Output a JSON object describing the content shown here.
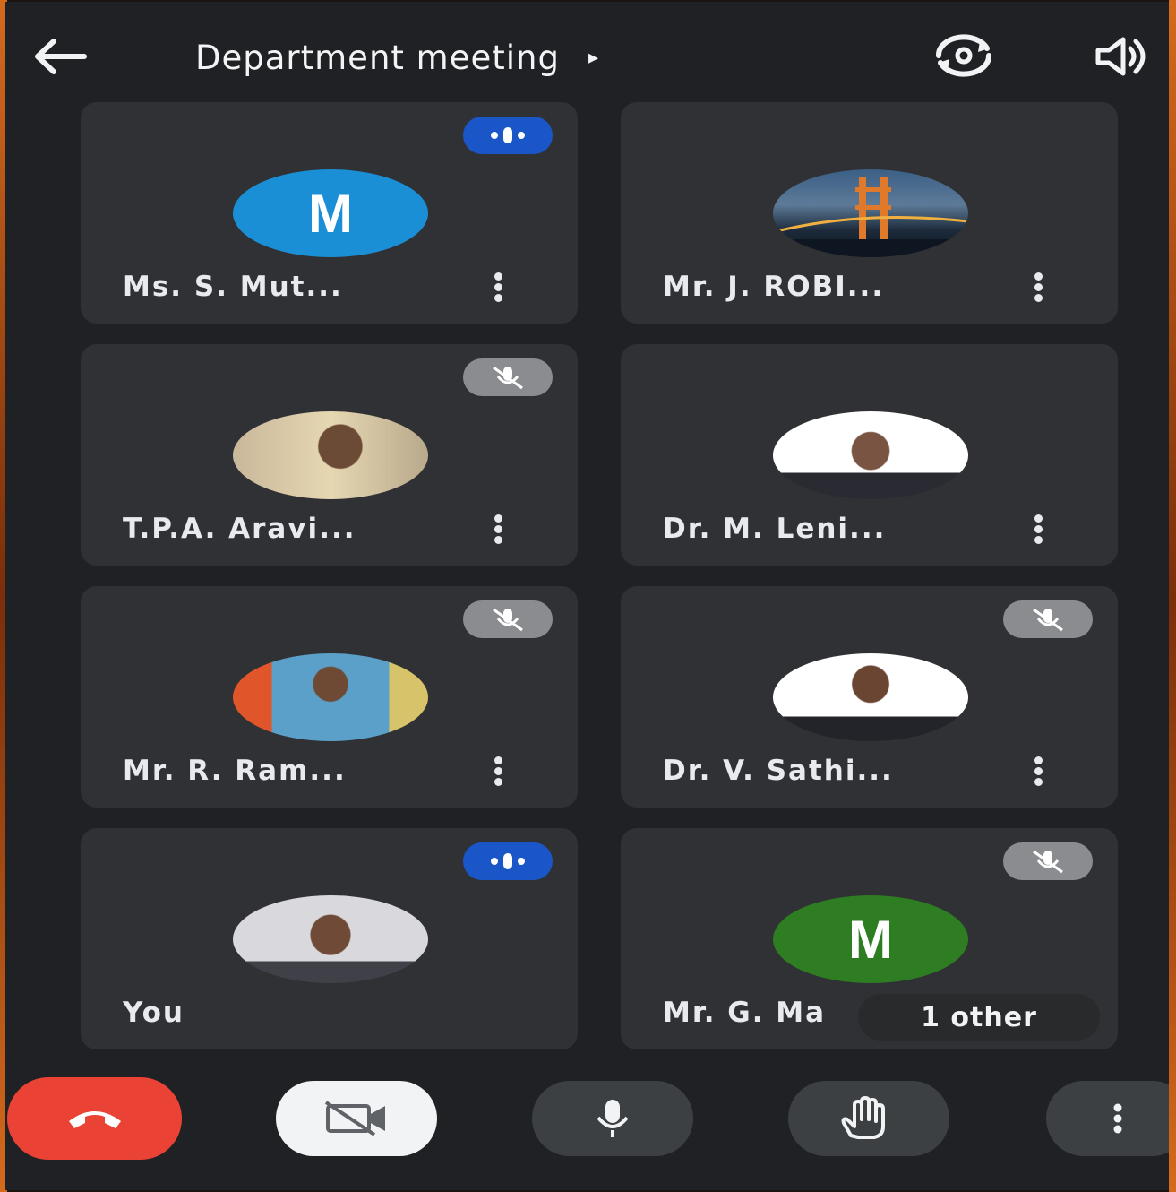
{
  "header": {
    "title": "Department meeting",
    "title_caret": "▸",
    "back_icon": "arrow-left-icon",
    "camera_flip_icon": "camera-flip-icon",
    "speaker_icon": "speaker-icon"
  },
  "participants": [
    {
      "name": "Ms. S. Mut...",
      "avatar_type": "initial",
      "initial": "M",
      "avatar_color": "#1a8fd6",
      "status": "speaking"
    },
    {
      "name": "Mr. J. ROBI...",
      "avatar_type": "photo",
      "status": "none"
    },
    {
      "name": "T.P.A. Aravi...",
      "avatar_type": "photo",
      "status": "muted"
    },
    {
      "name": "Dr. M. Leni...",
      "avatar_type": "photo",
      "status": "none"
    },
    {
      "name": "Mr. R. Ram...",
      "avatar_type": "photo",
      "status": "muted"
    },
    {
      "name": "Dr. V. Sathi...",
      "avatar_type": "photo",
      "status": "muted"
    },
    {
      "name": "You",
      "avatar_type": "photo",
      "status": "speaking"
    },
    {
      "name": "Mr. G. Ma",
      "avatar_type": "initial",
      "initial": "M",
      "avatar_color": "#2e7d22",
      "status": "muted",
      "others_label": "1 other"
    }
  ],
  "controls": {
    "end_call_icon": "phone-hangup-icon",
    "video_icon": "video-off-icon",
    "mic_icon": "microphone-icon",
    "hand_icon": "raise-hand-icon",
    "more_icon": "more-vertical-icon"
  },
  "colors": {
    "background": "#202124",
    "tile": "#303134",
    "end_call": "#ea4335",
    "speaking_badge": "#1a56c7",
    "muted_badge": "#8a8c8f"
  }
}
